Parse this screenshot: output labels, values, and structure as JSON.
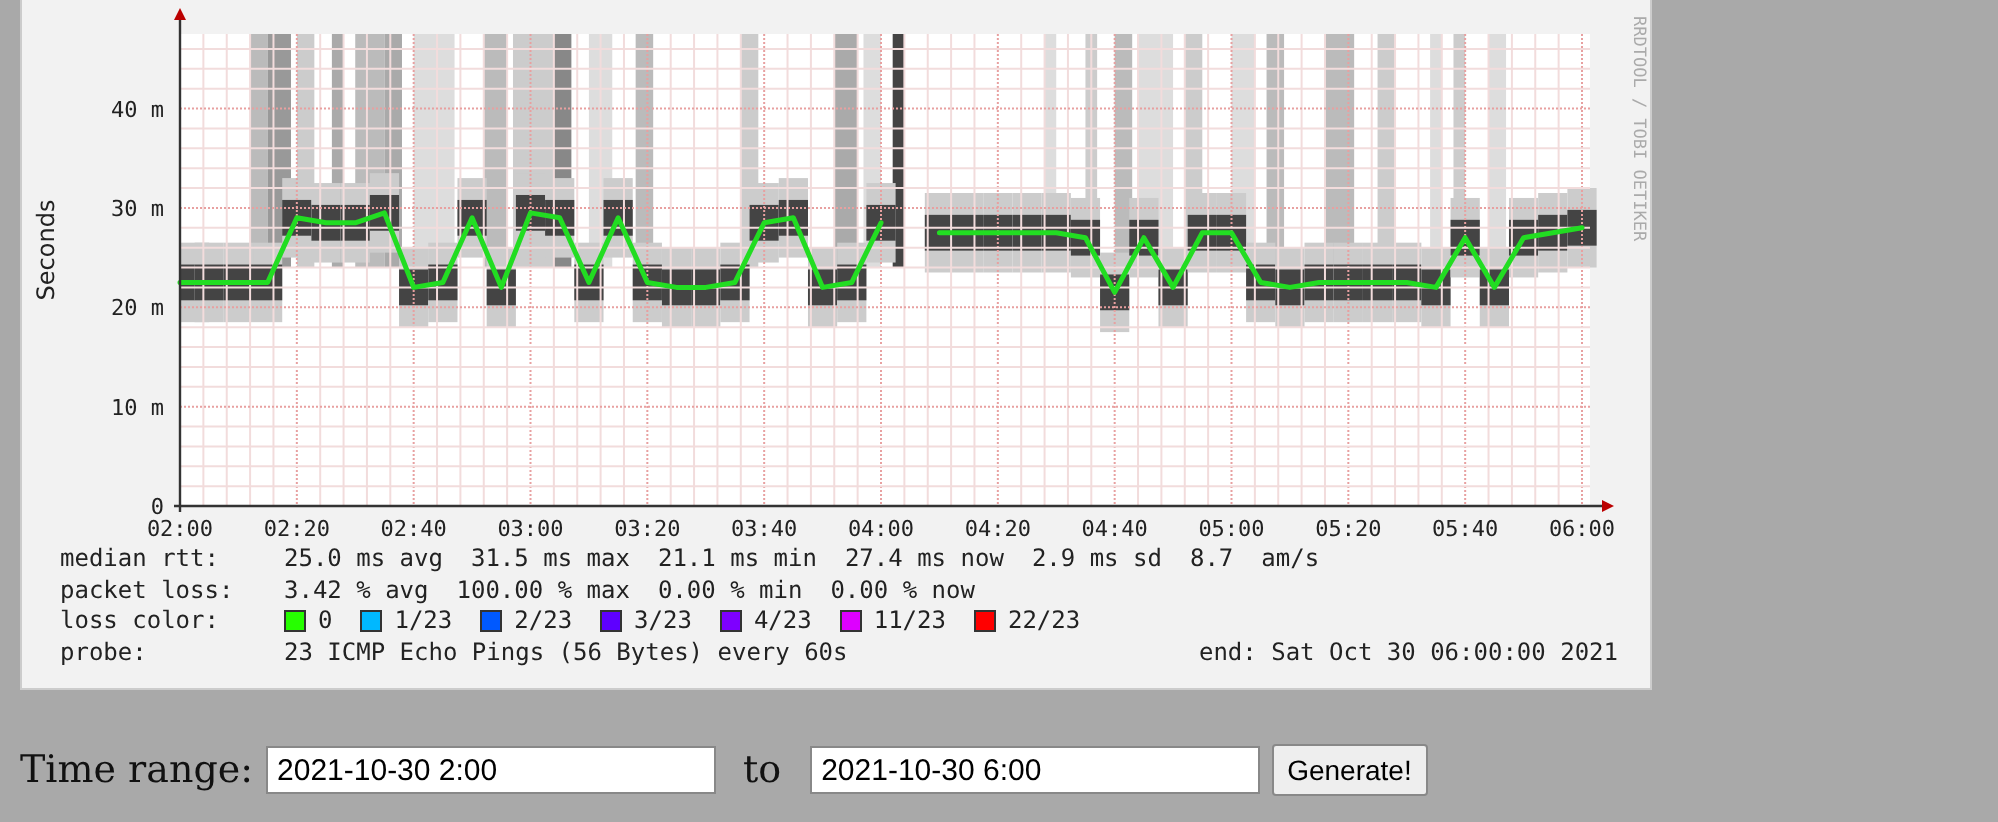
{
  "graph": {
    "watermark_side": "RRDTOOL / TOBI OETIKER",
    "chart_data": {
      "type": "line",
      "ylabel": "Seconds",
      "categories": [
        "02:00",
        null,
        null,
        null,
        "02:20",
        null,
        null,
        null,
        "02:40",
        null,
        null,
        null,
        "03:00",
        null,
        null,
        null,
        "03:20",
        null,
        null,
        null,
        "03:40",
        null,
        null,
        null,
        "04:00",
        null,
        null,
        null,
        "04:20",
        null,
        null,
        null,
        "04:40",
        null,
        null,
        null,
        "05:00",
        null,
        null,
        null,
        "05:20",
        null,
        null,
        null,
        "05:40",
        null,
        null,
        null,
        "06:00"
      ],
      "series": [
        {
          "color": "#22dd22",
          "values": [
            22.5,
            22.5,
            22.5,
            22.5,
            29,
            28.5,
            28.5,
            29.5,
            22,
            22.5,
            29,
            22,
            29.5,
            29,
            22.5,
            29,
            22.5,
            22,
            22,
            22.5,
            28.5,
            29,
            22,
            22.5,
            28.5,
            null,
            27.5,
            27.5,
            27.5,
            27.5,
            27.5,
            27,
            21.5,
            27,
            22,
            27.5,
            27.5,
            22.5,
            22,
            22.5,
            22.5,
            22.5,
            22.5,
            22,
            27,
            22,
            27,
            27.5,
            28
          ]
        }
      ],
      "ylim": [
        0,
        47.5
      ],
      "grid": true,
      "yticks": [
        {
          "value": 0,
          "label": "0"
        },
        {
          "value": 10,
          "label": "10 m"
        },
        {
          "value": 20,
          "label": "20 m"
        },
        {
          "value": 30,
          "label": "30 m"
        },
        {
          "value": 40,
          "label": "40 m"
        }
      ]
    }
  },
  "legend": {
    "rows": [
      {
        "kind": "text",
        "label": "median rtt:",
        "items": [
          "25.0 ms avg",
          "31.5 ms max",
          "21.1 ms min",
          "27.4 ms now",
          "2.9 ms sd",
          "8.7",
          "am/s"
        ]
      },
      {
        "kind": "text",
        "label": "packet loss:",
        "items": [
          "3.42 % avg",
          "100.00 % max",
          "0.00 % min",
          "0.00 % now"
        ]
      },
      {
        "kind": "colors",
        "label": "loss color:",
        "swatches": [
          {
            "text": "0",
            "color": "#26ff00"
          },
          {
            "text": "1/23",
            "color": "#00b8ff"
          },
          {
            "text": "2/23",
            "color": "#0059ff"
          },
          {
            "text": "3/23",
            "color": "#5e00ff"
          },
          {
            "text": "4/23",
            "color": "#7e00ff"
          },
          {
            "text": "11/23",
            "color": "#dd00ff"
          },
          {
            "text": "22/23",
            "color": "#ff0000"
          }
        ]
      },
      {
        "kind": "probe",
        "label": "probe:",
        "items": [
          "23 ICMP Echo Pings (56 Bytes) every 60s"
        ],
        "end": "end: Sat Oct 30 06:00:00 2021"
      }
    ]
  },
  "form": {
    "label": "Time range:",
    "start": "2021-10-30 2:00",
    "joiner": "to",
    "finish": "2021-10-30 6:00",
    "button": "Generate!"
  }
}
